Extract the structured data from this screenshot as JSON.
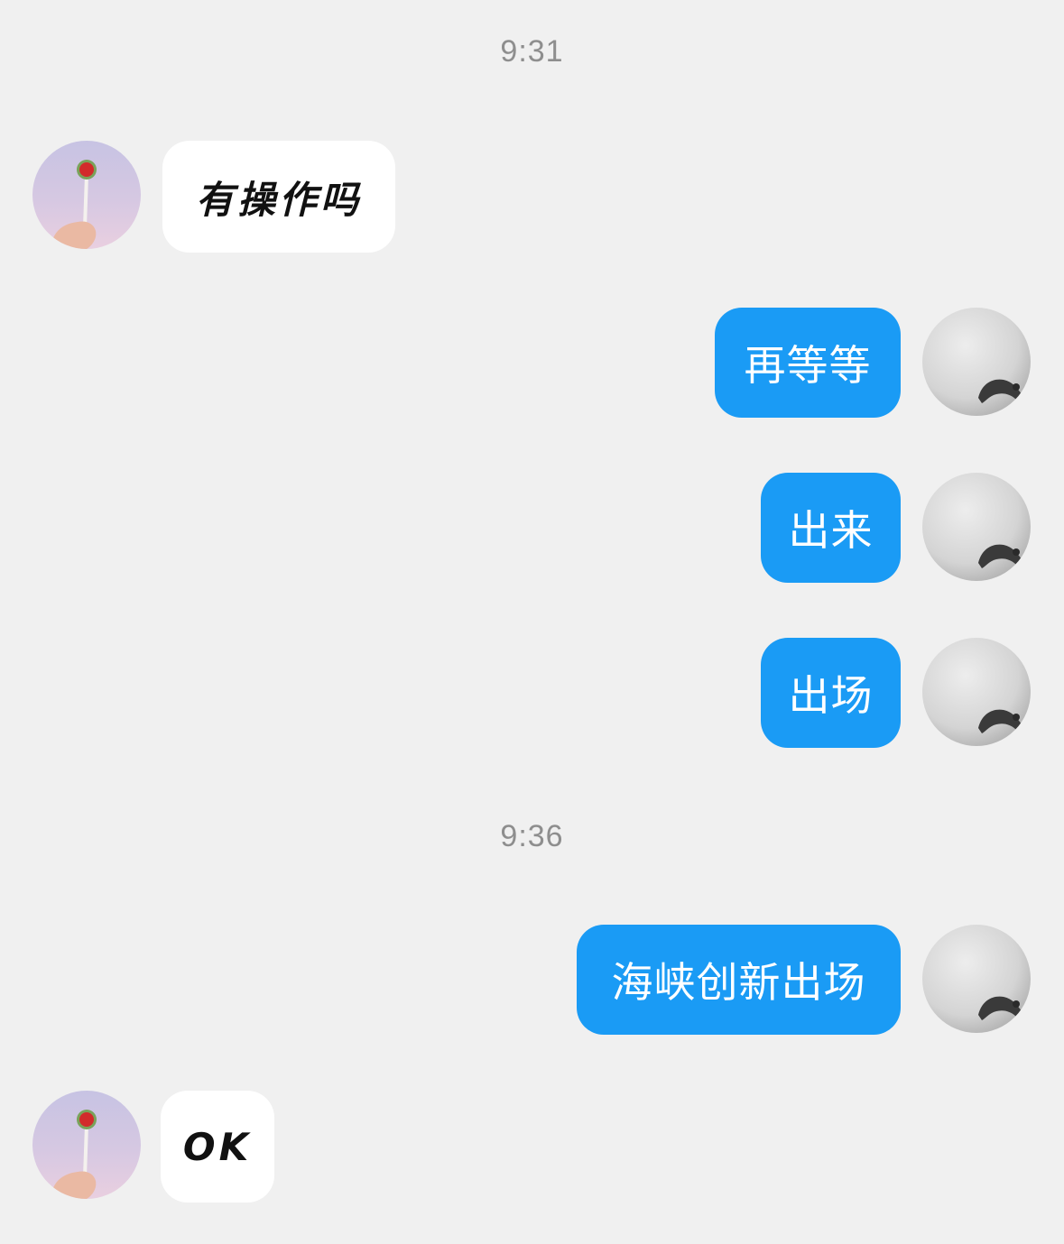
{
  "timestamps": [
    "9:31",
    "9:36"
  ],
  "messages": [
    {
      "side": "left",
      "text": "有操作吗"
    },
    {
      "side": "right",
      "text": "再等等"
    },
    {
      "side": "right",
      "text": "出来"
    },
    {
      "side": "right",
      "text": "出场"
    },
    {
      "side": "right",
      "text": "海峡创新出场"
    },
    {
      "side": "left",
      "text": "OK"
    }
  ],
  "colors": {
    "background": "#f0f0f0",
    "outgoing_bubble": "#1a9bf5",
    "incoming_bubble": "#ffffff",
    "timestamp": "#8e8e8e"
  },
  "icons": {
    "contact_avatar": "lollipop-avatar-icon",
    "self_avatar": "grey-moon-avatar-icon"
  }
}
